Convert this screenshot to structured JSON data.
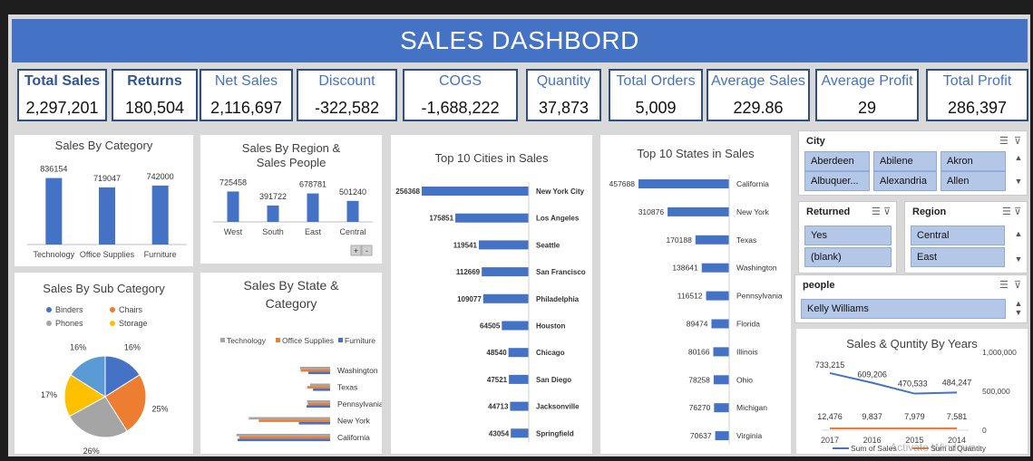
{
  "title": "SALES DASHBORD",
  "kpis": [
    {
      "label": "Total Sales",
      "value": "2,297,201",
      "bold": true
    },
    {
      "label": "Returns",
      "value": "180,504",
      "bold": true
    },
    {
      "label": "Net Sales",
      "value": "2,116,697"
    },
    {
      "label": "Discount",
      "value": "-322,582"
    },
    {
      "label": "COGS",
      "value": "-1,688,222"
    },
    {
      "label": "Quantity",
      "value": "37,873"
    },
    {
      "label": "Total Orders",
      "value": "5,009"
    },
    {
      "label": "Average Sales",
      "value": "229.86"
    },
    {
      "label": "Average Profit",
      "value": "29"
    },
    {
      "label": "Total Profit",
      "value": "286,397"
    }
  ],
  "colors": {
    "blue": "#4472c4",
    "orange": "#ed7d31",
    "gray": "#a5a5a5",
    "gold": "#ffc000",
    "light_blue": "#5b9bd5"
  },
  "chart_data": [
    {
      "id": "cat",
      "type": "bar",
      "title": "Sales By Category",
      "categories": [
        "Technology",
        "Office Supplies",
        "Furniture"
      ],
      "values": [
        836154,
        719047,
        742000
      ],
      "ylim": [
        0,
        900000
      ]
    },
    {
      "id": "region",
      "type": "bar",
      "title": "Sales By Region & Sales People",
      "categories": [
        "West",
        "South",
        "East",
        "Central"
      ],
      "values": [
        725458,
        391722,
        678781,
        501240
      ],
      "ylim": [
        0,
        800000
      ],
      "buttons": [
        "+",
        "-"
      ]
    },
    {
      "id": "cities",
      "type": "bar",
      "orientation": "horizontal",
      "title": "Top 10 Cities in Sales",
      "categories": [
        "New York City",
        "Los Angeles",
        "Seattle",
        "San Francisco",
        "Philadelphia",
        "Houston",
        "Chicago",
        "San Diego",
        "Jacksonville",
        "Springfield"
      ],
      "values": [
        256368,
        175851,
        119541,
        112669,
        109077,
        64505,
        48540,
        47521,
        44713,
        43054
      ]
    },
    {
      "id": "states",
      "type": "bar",
      "orientation": "horizontal",
      "title": "Top 10 States in Sales",
      "categories": [
        "California",
        "New York",
        "Texas",
        "Washington",
        "Pennsylvania",
        "Florida",
        "Illinois",
        "Ohio",
        "Michigan",
        "Virginia"
      ],
      "values": [
        457688,
        310876,
        170188,
        138641,
        116512,
        89474,
        80166,
        78258,
        76270,
        70637
      ]
    },
    {
      "id": "subcat",
      "type": "pie",
      "title": "Sales By Sub Category",
      "legend": [
        "Binders",
        "Chairs",
        "Phones",
        "Storage"
      ],
      "slices": [
        {
          "name": "Binders",
          "percent": 16,
          "label": "16%"
        },
        {
          "name": "Chairs",
          "percent": 25,
          "label": "25%"
        },
        {
          "name": "Phones",
          "percent": 26,
          "label": "26%"
        },
        {
          "name": "Storage",
          "percent": 17,
          "label": "17%"
        },
        {
          "name": "",
          "percent": 16,
          "label": "16%"
        }
      ]
    },
    {
      "id": "statecat",
      "type": "bar",
      "orientation": "horizontal",
      "title": "Sales By State & Category",
      "legend": [
        "Technology",
        "Office Supplies",
        "Furniture"
      ],
      "categories": [
        "Washington",
        "Texas",
        "Pennsylvania",
        "New York",
        "California"
      ],
      "series": [
        {
          "name": "Technology",
          "values": [
            51000,
            34000,
            39000,
            138000,
            159000
          ]
        },
        {
          "name": "Office Supplies",
          "values": [
            50000,
            39000,
            38000,
            121000,
            154000
          ]
        },
        {
          "name": "Furniture",
          "values": [
            37000,
            29000,
            40000,
            53000,
            157000
          ]
        }
      ],
      "xticks": [
        "200000",
        "100000",
        "0"
      ],
      "xlim": [
        0,
        200000
      ]
    },
    {
      "id": "years",
      "type": "line",
      "title": "Sales & Quntity By Years",
      "x": [
        "2017",
        "2016",
        "2015",
        "2014"
      ],
      "series": [
        {
          "name": "Sum of Sales",
          "values": [
            733215,
            609206,
            470533,
            484247
          ],
          "labels": [
            "733,215",
            "609,206",
            "470,533",
            "484,247"
          ]
        },
        {
          "name": "Sum of Quantity",
          "values": [
            12476,
            9837,
            7979,
            7581
          ],
          "labels": [
            "12,476",
            "9,837",
            "7,979",
            "7,581"
          ]
        }
      ],
      "y2ticks": [
        "1,000,000",
        "500,000",
        "0"
      ]
    }
  ],
  "slicers": {
    "city": {
      "header": "City",
      "items": [
        "Aberdeen",
        "Abilene",
        "Akron",
        "Albuquer...",
        "Alexandria",
        "Allen"
      ]
    },
    "returned": {
      "header": "Returned",
      "items": [
        "Yes",
        "(blank)"
      ]
    },
    "region": {
      "header": "Region",
      "items": [
        "Central",
        "East"
      ]
    },
    "people": {
      "header": "people",
      "items": [
        "Kelly Williams"
      ]
    }
  },
  "watermark": "Activate Windows"
}
